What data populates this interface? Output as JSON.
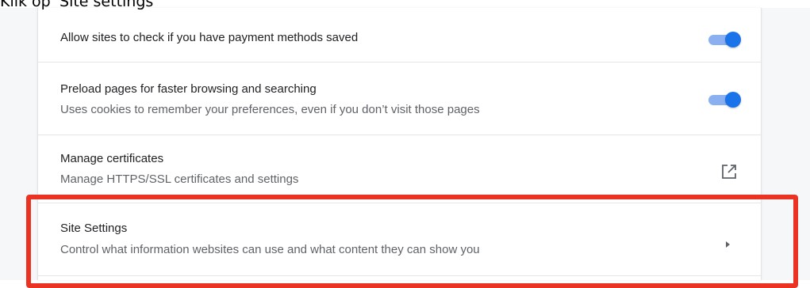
{
  "caption": "Klik op 'Site settings'",
  "settings": {
    "payment": {
      "title": "Allow sites to check if you have payment methods saved",
      "toggle_on": true
    },
    "preload": {
      "title": "Preload pages for faster browsing and searching",
      "subtitle": "Uses cookies to remember your preferences, even if you don’t visit those pages",
      "toggle_on": true
    },
    "certificates": {
      "title": "Manage certificates",
      "subtitle": "Manage HTTPS/SSL certificates and settings",
      "icon": "open-in-new-icon"
    },
    "site_settings": {
      "title": "Site Settings",
      "subtitle": "Control what information websites can use and what content they can show you",
      "icon": "arrow-right-icon"
    }
  },
  "colors": {
    "accent": "#1a73e8",
    "toggle_track": "#8ab0f2",
    "highlight": "#ea3323"
  }
}
